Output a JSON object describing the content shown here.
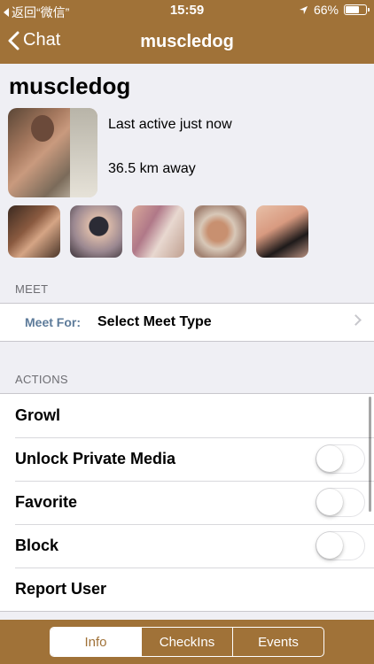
{
  "status_bar": {
    "back_app": "返回“微信”",
    "time": "15:59",
    "battery": "66%",
    "battery_level": 0.66
  },
  "nav": {
    "back_label": "Chat",
    "title": "muscledog"
  },
  "profile": {
    "username": "muscledog",
    "last_active": "Last active just now",
    "distance": "36.5 km away"
  },
  "meet_section": {
    "header": "MEET",
    "label": "Meet For:",
    "value": "Select Meet Type"
  },
  "actions_section": {
    "header": "ACTIONS",
    "items": [
      {
        "label": "Growl"
      },
      {
        "label": "Unlock Private Media",
        "toggle": false
      },
      {
        "label": "Favorite",
        "toggle": false
      },
      {
        "label": "Block",
        "toggle": false
      },
      {
        "label": "Report User"
      }
    ]
  },
  "tabs": {
    "items": [
      "Info",
      "CheckIns",
      "Events"
    ],
    "selected": "Info"
  },
  "colors": {
    "brand": "#a07238",
    "meet_label": "#5d7b9a",
    "background": "#efeff4"
  }
}
